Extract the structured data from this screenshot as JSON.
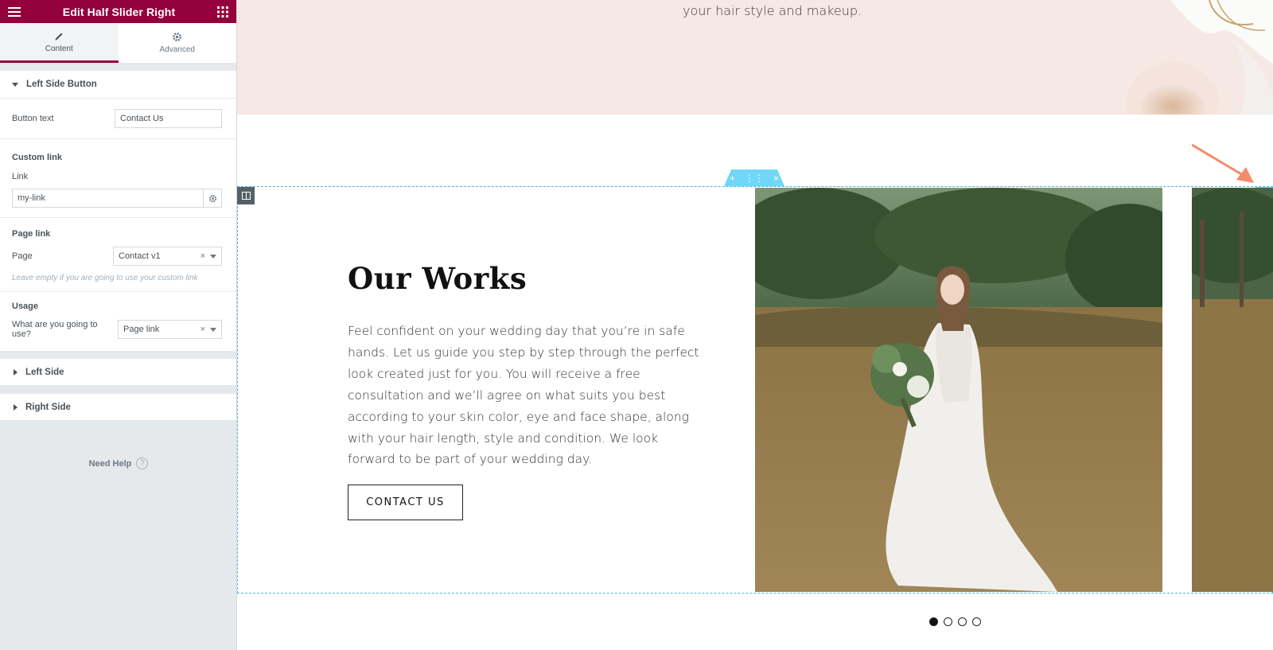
{
  "panel": {
    "title": "Edit Half Slider Right",
    "tabs": [
      {
        "label": "Content",
        "icon": "pencil-icon"
      },
      {
        "label": "Advanced",
        "icon": "gear-icon"
      }
    ],
    "left_side_button": {
      "heading": "Left Side Button",
      "button_text_label": "Button text",
      "button_text_value": "Contact Us",
      "custom_link_heading": "Custom link",
      "link_label": "Link",
      "link_value": "my-link",
      "page_link_heading": "Page link",
      "page_label": "Page",
      "page_value": "Contact v1",
      "page_hint": "Leave empty if you are going to use your custom link",
      "usage_heading": "Usage",
      "usage_label": "What are you going to use?",
      "usage_value": "Page link",
      "clear_symbol": "×"
    },
    "sections": [
      "Left Side",
      "Right Side"
    ],
    "need_help": "Need Help",
    "help_symbol": "?"
  },
  "canvas": {
    "tagline": "your hair style and makeup.",
    "heading": "Our Works",
    "paragraph": "Feel confident on your wedding day that you’re in safe hands. Let us guide you step by step through the perfect look created just for you. You will receive a free consultation and we’ll agree on what suits you best according to your skin color, eye and face shape, along with your hair length, style and condition. We look forward to be part of your wedding day.",
    "cta_label": "CONTACT US",
    "toolbar": {
      "add": "+",
      "move": "⋮⋮",
      "close": "×"
    },
    "slider": {
      "total": 4,
      "active": 1
    }
  },
  "colors": {
    "brand": "#93003c",
    "accent": "#71d7f7",
    "arrow": "#f48b6a"
  }
}
